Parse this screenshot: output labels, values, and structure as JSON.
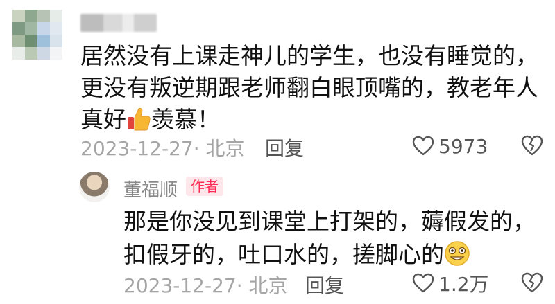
{
  "comment1": {
    "text_line1": "居然没有上课走神儿的学生，也没有睡觉的，",
    "text_line2": "更没有叛逆期跟老师翻白眼顶嘴的，教老年人",
    "text_line3a": "真好",
    "text_line3b": "羡慕！",
    "thumb_emoji_icon": "thumbs-up-icon",
    "date": "2023-12-27",
    "location": "· 北京",
    "reply_label": "回复",
    "like_count": "5973"
  },
  "comment2": {
    "author": "董福顺",
    "badge": "作者",
    "text_line1": "那是你没见到课堂上打架的，薅假发的，",
    "text_line2": "扣假牙的，吐口水的，搓脚心的",
    "emoji_icon": "grinning-emoji-icon",
    "date": "2023-12-27",
    "location": "· 北京",
    "reply_label": "回复",
    "like_count": "1.2万"
  },
  "colors": {
    "accent": "#fe2c55",
    "muted": "#a6a6a6"
  }
}
